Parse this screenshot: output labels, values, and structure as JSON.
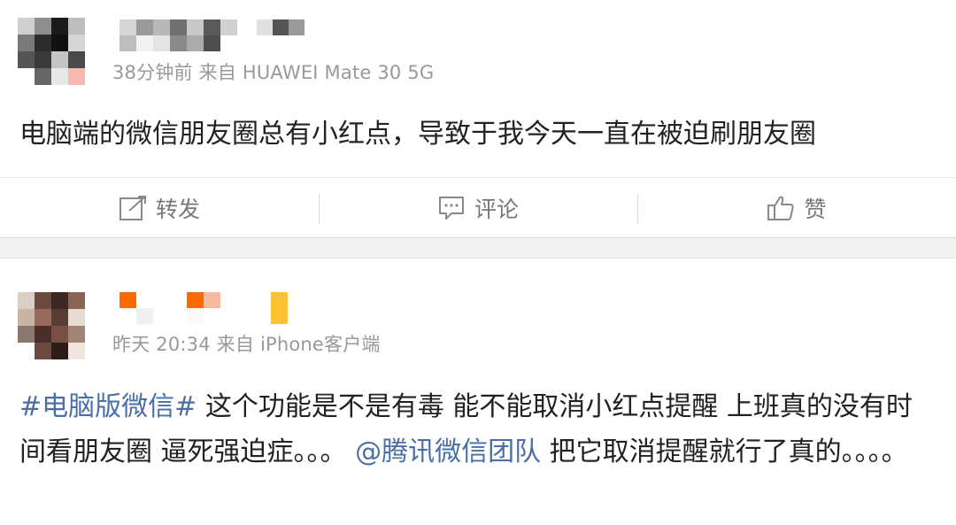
{
  "post1": {
    "meta": "38分钟前 来自 HUAWEI Mate 30 5G",
    "text": "电脑端的微信朋友圈总有小红点，导致于我今天一直在被迫刷朋友圈",
    "actions": {
      "repost": {
        "label": "转发",
        "icon": "share-icon"
      },
      "comment": {
        "label": "评论",
        "icon": "comment-icon"
      },
      "like": {
        "label": "赞",
        "icon": "thumbs-up-icon"
      }
    }
  },
  "post2": {
    "meta": "昨天 20:34 来自 iPhone客户端",
    "text_topic": "#电脑版微信#",
    "text_part1": " 这个功能是不是有毒 能不能取消小红点提醒 上班真的没有时间看朋友圈 逼死强迫症。。。 ",
    "text_mention": "@腾讯微信团队",
    "text_part2": " 把它取消提醒就行了真的。。。。"
  },
  "colors": {
    "link": "#4a6fa5",
    "meta": "#999999",
    "text": "#222222",
    "separator": "#f2f2f2"
  }
}
